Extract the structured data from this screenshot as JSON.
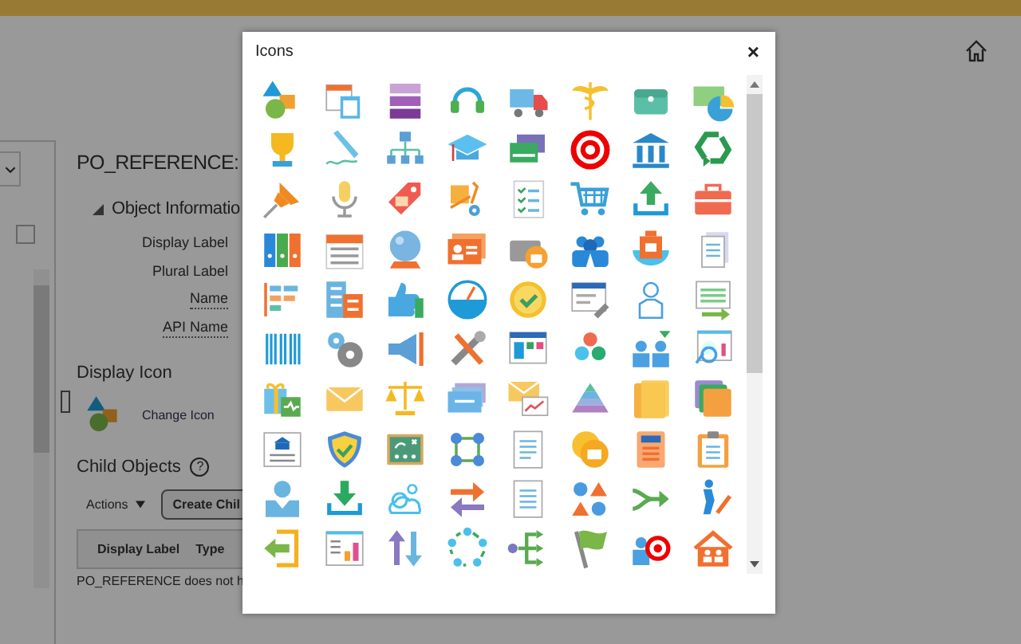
{
  "left_panel": {
    "filter_checked": false
  },
  "page": {
    "title": "PO_REFERENCE:",
    "section": {
      "title": "Object Informatio",
      "expanded": true
    },
    "field_labels": [
      "Display Label",
      "Plural Label",
      "Name",
      "API Name"
    ],
    "display_icon": {
      "title": "Display Icon",
      "link": "Change Icon"
    },
    "child_objects": {
      "title": "Child Objects",
      "help": "?",
      "actions": "Actions",
      "create_button": "Create Chil",
      "columns": [
        "Display Label",
        "Type"
      ],
      "empty_message": "PO_REFERENCE does not h"
    }
  },
  "dialog": {
    "title": "Icons",
    "close": "×"
  }
}
